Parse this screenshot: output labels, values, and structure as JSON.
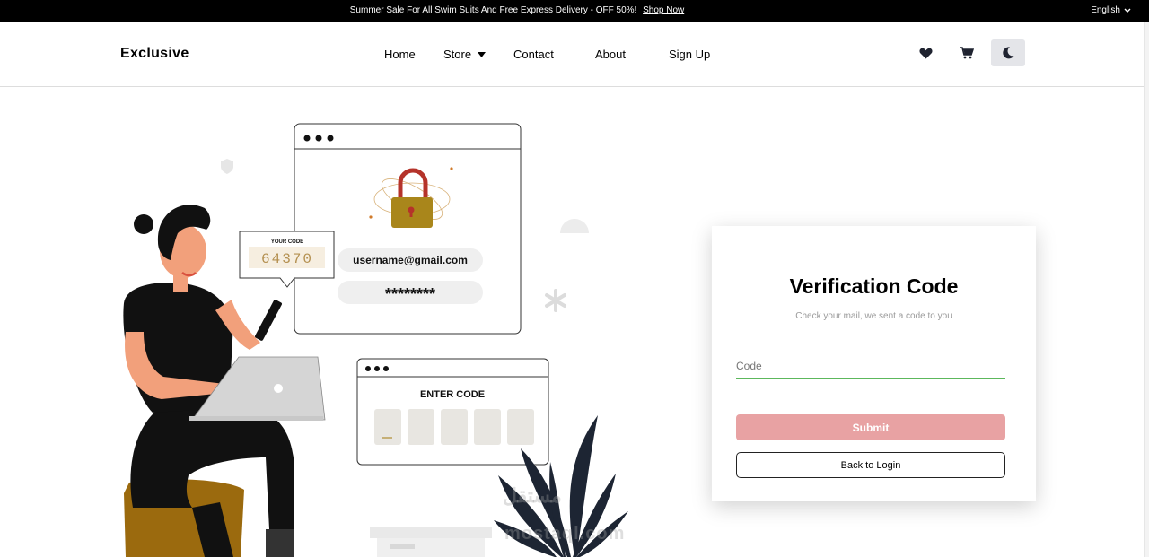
{
  "topbar": {
    "promo_text": "Summer Sale For All Swim Suits And Free Express Delivery - OFF 50%!",
    "promo_link": "Shop Now",
    "language": "English"
  },
  "header": {
    "logo": "Exclusive",
    "nav": {
      "home": "Home",
      "store": "Store",
      "contact": "Contact",
      "about": "About",
      "signup": "Sign Up"
    },
    "icons": [
      "heart-icon",
      "cart-icon",
      "moon-icon"
    ]
  },
  "illustration": {
    "your_code_label": "YOUR CODE",
    "code_value": "64370",
    "email": "username@gmail.com",
    "password_mask": "********",
    "enter_code_label": "ENTER CODE"
  },
  "verification": {
    "title": "Verification Code",
    "subtitle": "Check your mail, we sent a code to you",
    "code_placeholder": "Code",
    "submit_label": "Submit",
    "back_label": "Back to Login"
  },
  "watermark": {
    "line1": "مستقل",
    "line2": "mostaql.com"
  },
  "colors": {
    "topbar_bg": "#000000",
    "submit_bg": "#e8a2a3",
    "input_underline": "#5cb85c",
    "lock_red": "#b5332a",
    "lock_gold": "#a9861b",
    "pouf_brown": "#9b6a0e"
  }
}
